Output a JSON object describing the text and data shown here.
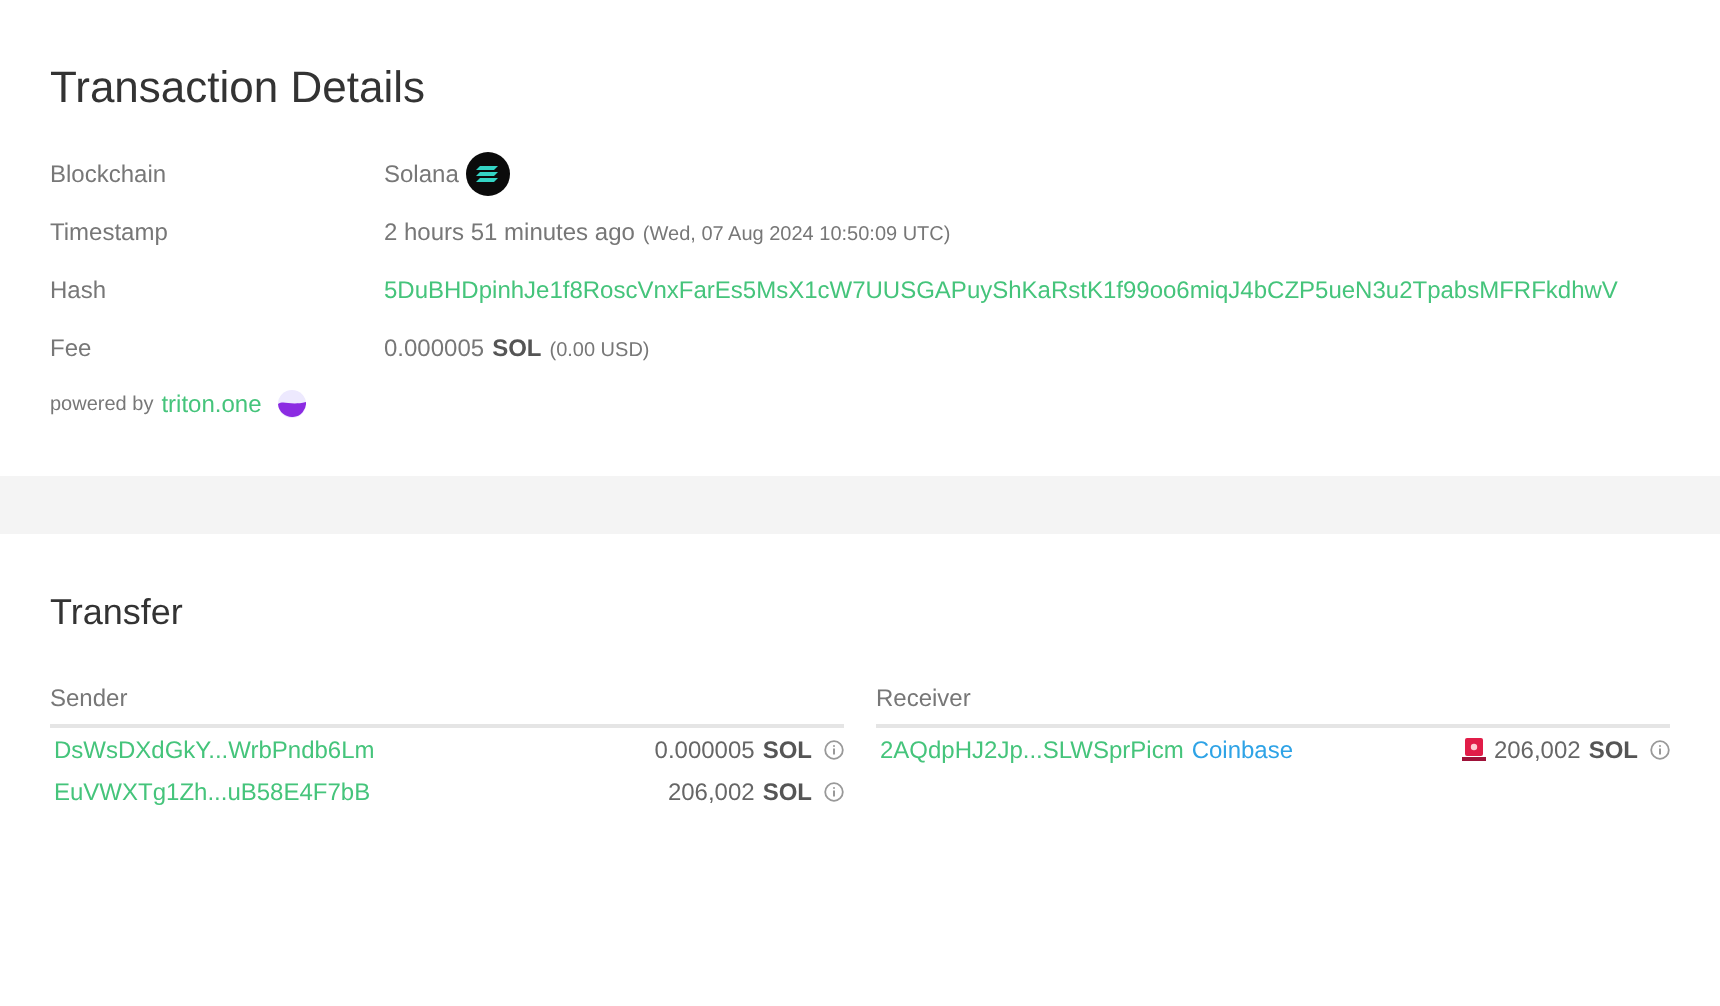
{
  "details": {
    "title": "Transaction Details",
    "rows": [
      {
        "kind": "chain",
        "label": "Blockchain",
        "value": "Solana"
      },
      {
        "kind": "time",
        "label": "Timestamp",
        "value": "2 hours 51 minutes ago",
        "detail": "(Wed, 07 Aug 2024 10:50:09 UTC)"
      },
      {
        "kind": "link",
        "label": "Hash",
        "value": "5DuBHDpinhJe1f8RoscVnxFarEs5MsX1cW7UUSGAPuyShKaRstK1f99oo6miqJ4bCZP5ueN3u2TpabsMFRFkdhwV"
      },
      {
        "kind": "fee",
        "label": "Fee",
        "value": "0.000005",
        "unit": "SOL",
        "detail": "(0.00 USD)"
      }
    ],
    "powered_by": {
      "text": "powered by",
      "link": "triton.one"
    }
  },
  "transfer": {
    "title": "Transfer",
    "sender": {
      "heading": "Sender",
      "rows": [
        {
          "address": "DsWsDXdGkY...WrbPndb6Lm",
          "amount": "0.000005",
          "unit": "SOL",
          "flagged": false
        },
        {
          "address": "EuVWXTg1Zh...uB58E4F7bB",
          "amount": "206,002",
          "unit": "SOL",
          "flagged": false
        }
      ]
    },
    "receiver": {
      "heading": "Receiver",
      "rows": [
        {
          "address": "2AQdpHJ2Jp...SLWSprPicm",
          "tag": "Coinbase",
          "amount": "206,002",
          "unit": "SOL",
          "flagged": true
        }
      ]
    }
  }
}
